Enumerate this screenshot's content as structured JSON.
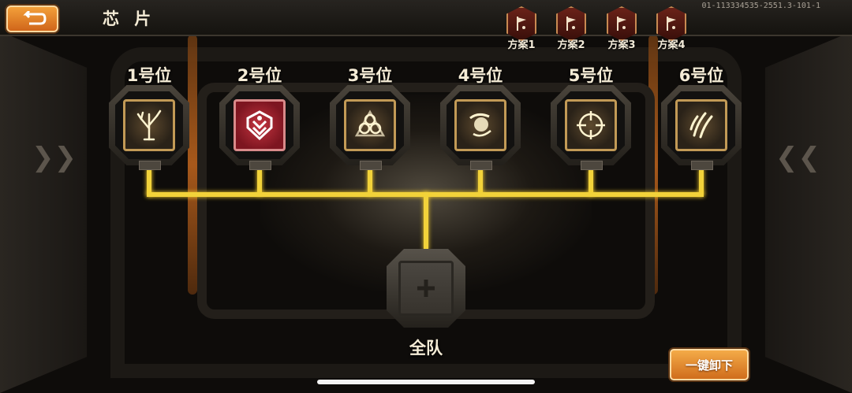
{
  "header": {
    "title": "芯 片",
    "build_id": "01-113334535-2551.3-101-1"
  },
  "plans": [
    {
      "label": "方案1"
    },
    {
      "label": "方案2"
    },
    {
      "label": "方案3"
    },
    {
      "label": "方案4"
    }
  ],
  "slots": [
    {
      "label": "1号位",
      "icon": "tree-icon",
      "style": "gold"
    },
    {
      "label": "2号位",
      "icon": "red-crest-icon",
      "style": "red"
    },
    {
      "label": "3号位",
      "icon": "hex-cluster-icon",
      "style": "gold"
    },
    {
      "label": "4号位",
      "icon": "burst-icon",
      "style": "gold"
    },
    {
      "label": "5号位",
      "icon": "crosshair-icon",
      "style": "gold"
    },
    {
      "label": "6号位",
      "icon": "claw-slash-icon",
      "style": "gold"
    }
  ],
  "team": {
    "label": "全队",
    "icon": "plus-icon"
  },
  "actions": {
    "unequip_all": "一键卸下"
  },
  "colors": {
    "accent_orange": "#e88a2a",
    "connector_yellow": "#f2d23a",
    "chip_gold": "#c29a56",
    "chip_red": "#b0263a"
  }
}
